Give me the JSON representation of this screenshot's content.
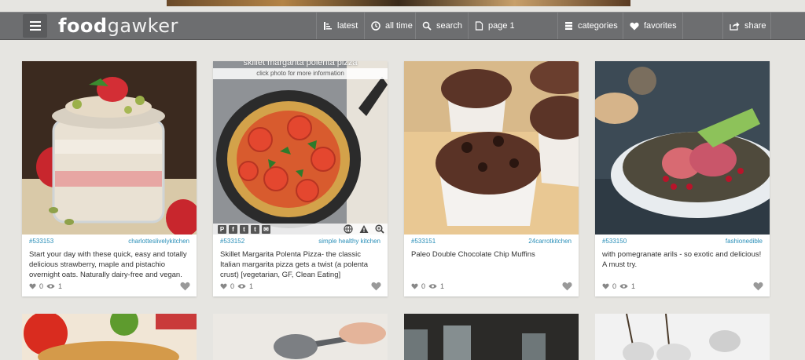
{
  "header": {
    "logo_bold": "food",
    "logo_light": "gawker",
    "nav": {
      "latest": "latest",
      "all_time": "all time",
      "search": "search",
      "page": "page 1",
      "categories": "categories",
      "favorites": "favorites",
      "share": "share"
    }
  },
  "cards": [
    {
      "id": "#533153",
      "source": "charlotteslivelykitchen",
      "description": "Start your day with these quick, easy and totally delicious strawberry, maple and pistachio overnight oats. Naturally dairy-free and vegan.",
      "favorites": "0",
      "views": "1"
    },
    {
      "id": "#533152",
      "source": "simple healthy kitchen",
      "overlay_title": "skillet margarita polenta pizza",
      "overlay_hint": "click photo for more information",
      "description": "Skillet Margarita Polenta Pizza- the classic Italian margarita pizza gets a twist (a polenta crust) [vegetarian, GF, Clean Eating]",
      "favorites": "0",
      "views": "1"
    },
    {
      "id": "#533151",
      "source": "24carrotkitchen",
      "description": "Paleo Double Chocolate Chip Muffins",
      "favorites": "0",
      "views": "1"
    },
    {
      "id": "#533150",
      "source": "fashionedible",
      "description": "with pomegranate arils - so exotic and delicious! A must try.",
      "favorites": "0",
      "views": "1"
    }
  ],
  "colors": {
    "navbar": "#6d6e70",
    "page_bg": "#e6e5e1",
    "link": "#2a8fb8"
  }
}
